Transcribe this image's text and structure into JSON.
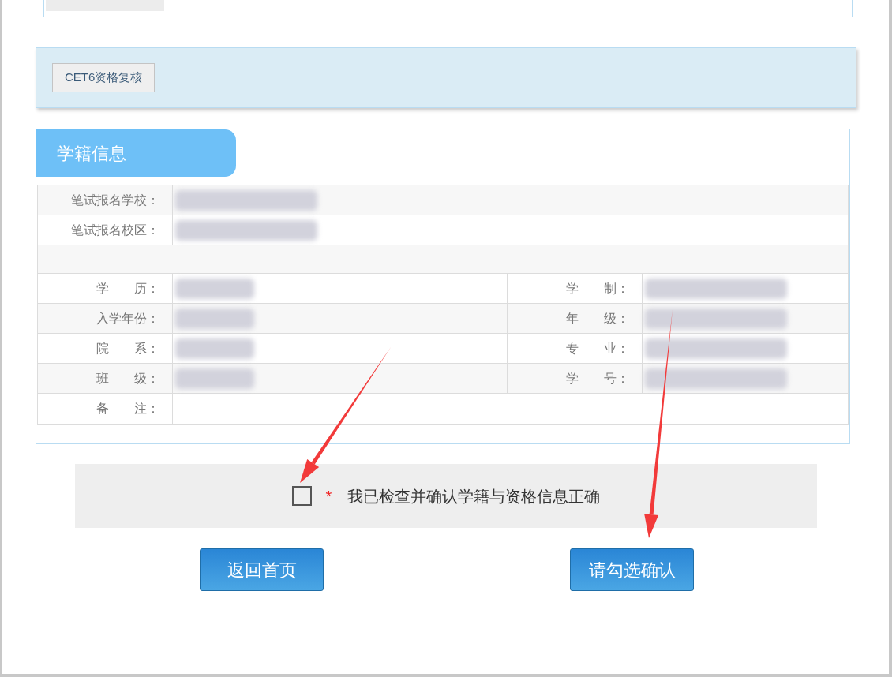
{
  "top_card": {
    "redacted": true
  },
  "qualification": {
    "button": "CET6资格复核"
  },
  "section": {
    "title": "学籍信息",
    "rows": [
      {
        "kind": "full",
        "label": "笔试报名学校：",
        "value_redacted": true
      },
      {
        "kind": "full",
        "label": "笔试报名校区：",
        "value_redacted": true
      },
      {
        "kind": "blank"
      },
      {
        "kind": "pair",
        "label": "学　　历：",
        "value_redacted": true,
        "label2": "学　　制：",
        "value2_redacted": true
      },
      {
        "kind": "pair",
        "label": "入学年份：",
        "value_redacted": true,
        "label2": "年　　级：",
        "value2_redacted": true
      },
      {
        "kind": "pair",
        "label": "院　　系：",
        "value_redacted": true,
        "label2": "专　　业：",
        "value2_redacted": true
      },
      {
        "kind": "pair",
        "label": "班　　级：",
        "value_redacted": true,
        "label2": "学　　号：",
        "value2_redacted": true
      },
      {
        "kind": "full",
        "label": "备　　注："
      }
    ]
  },
  "confirm": {
    "checked": false,
    "required_mark": "*",
    "label": "我已检查并确认学籍与资格信息正确"
  },
  "buttons": [
    "返回首页",
    "请勾选确认"
  ],
  "annotations": [
    {
      "kind": "arrow"
    },
    {
      "kind": "arrow"
    }
  ]
}
